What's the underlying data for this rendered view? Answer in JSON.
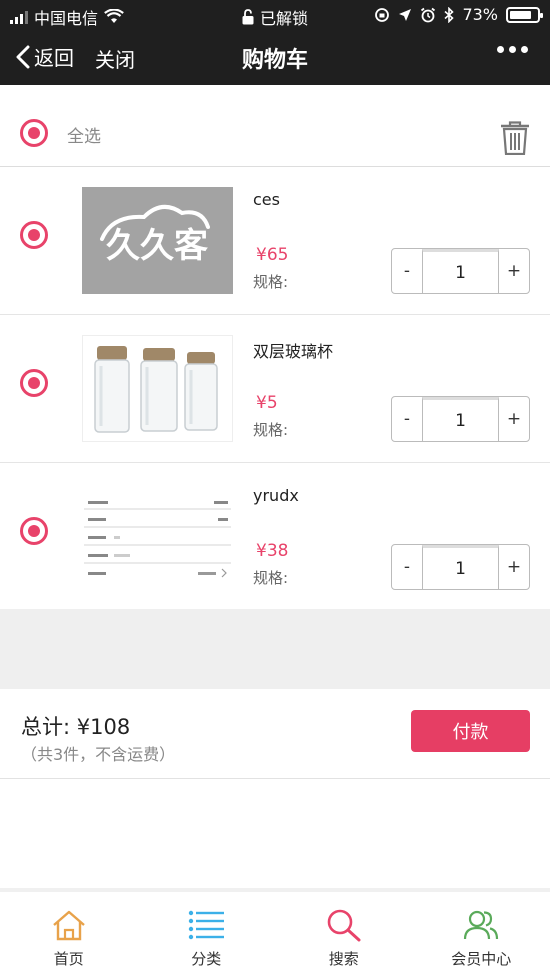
{
  "status_bar": {
    "carrier": "中国电信",
    "lock_text": "已解锁",
    "battery": "73%"
  },
  "nav": {
    "back_label": "返回",
    "close_label": "关闭",
    "title": "购物车"
  },
  "select_all": {
    "label": "全选"
  },
  "items": [
    {
      "name": "ces",
      "price": "¥65",
      "spec_label": "规格:",
      "qty": "1",
      "minus": "-",
      "plus": "+",
      "thumb_text": "久久客"
    },
    {
      "name": "双层玻璃杯",
      "price": "¥5",
      "spec_label": "规格:",
      "qty": "1",
      "minus": "-",
      "plus": "+"
    },
    {
      "name": "yrudx",
      "price": "¥38",
      "spec_label": "规格:",
      "qty": "1",
      "minus": "-",
      "plus": "+"
    }
  ],
  "total": {
    "label": "总计:  ¥108",
    "note": "（共3件，不含运费）",
    "pay_label": "付款"
  },
  "tabbar": [
    {
      "label": "首页",
      "icon": "home-icon"
    },
    {
      "label": "分类",
      "icon": "list-icon"
    },
    {
      "label": "搜索",
      "icon": "search-icon"
    },
    {
      "label": "会员中心",
      "icon": "users-icon"
    }
  ],
  "colors": {
    "accent": "#e8436a",
    "header_bg": "#1f1f1f"
  }
}
